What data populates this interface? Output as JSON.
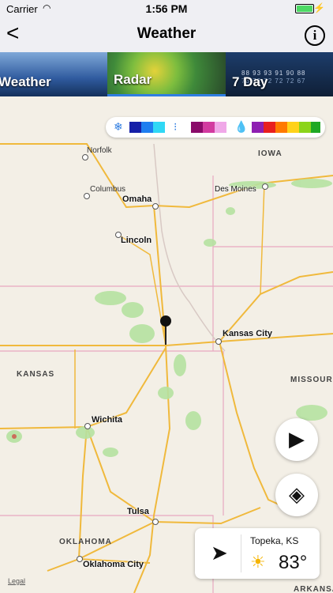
{
  "status_bar": {
    "carrier": "Carrier",
    "time": "1:56 PM"
  },
  "nav": {
    "title": "Weather",
    "back": "<",
    "info": "i"
  },
  "tabs": [
    {
      "label": "Weather"
    },
    {
      "label": "Radar"
    },
    {
      "label": "7 Day"
    }
  ],
  "seven_day_preview": {
    "row1": "88 93 93 91 90 88",
    "row2": "73 72 72 72 72 67"
  },
  "map": {
    "legal": "Legal",
    "states": [
      "IOWA",
      "KANSAS",
      "MISSOURI",
      "OKLAHOMA",
      "ARKANSAS"
    ],
    "small_places": [
      "Norfolk",
      "Columbus"
    ],
    "cities": [
      "Omaha",
      "Des Moines",
      "Lincoln",
      "Kansas City",
      "Wichita",
      "Tulsa",
      "Oklahoma City"
    ]
  },
  "legend": {
    "snow_colors": [
      "#1620a8",
      "#1f7ef0",
      "#30d8f5"
    ],
    "mix_colors": [
      "#8a0b6a",
      "#d23ba0",
      "#f0a8e8"
    ],
    "rain_colors": [
      "#8e1fb2",
      "#e81f1f",
      "#ff7a00",
      "#ffd21a",
      "#8bd41a",
      "#1fa824"
    ]
  },
  "location_card": {
    "name": "Topeka, KS",
    "temp": "83°"
  }
}
